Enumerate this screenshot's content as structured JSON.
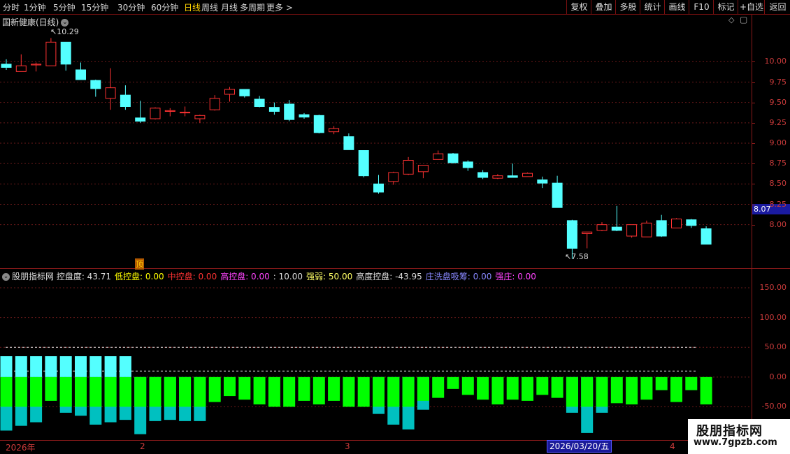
{
  "toolbar": {
    "periods": [
      "分时",
      "1分钟",
      "5分钟",
      "15分钟",
      "30分钟",
      "60分钟",
      "日线",
      "周线",
      "月线",
      "多周期",
      "更多 >"
    ],
    "active_period": "日线",
    "right_buttons": [
      "复权",
      "叠加",
      "多股",
      "统计",
      "画线",
      "F10",
      "标记",
      "+自选",
      "返回"
    ]
  },
  "chart": {
    "title": "国新健康(日线)",
    "high_label": "10.29",
    "low_label": "7.58",
    "current_price": "8.07",
    "marker": "顶",
    "y_ticks": [
      "10.00",
      "9.75",
      "9.50",
      "9.25",
      "9.00",
      "8.75",
      "8.50",
      "8.25",
      "8.00"
    ]
  },
  "indicator": {
    "name": "股朋指标网",
    "fields": [
      {
        "label": "控盘度:",
        "value": "43.71",
        "color": "#dddddd"
      },
      {
        "label": "低控盘:",
        "value": "0.00",
        "color": "#ffff00"
      },
      {
        "label": "中控盘:",
        "value": "0.00",
        "color": "#ff3333"
      },
      {
        "label": "高控盘:",
        "value": "0.00",
        "color": "#ff44ff"
      },
      {
        "label": ":",
        "value": "10.00",
        "color": "#dddddd"
      },
      {
        "label": "强弱:",
        "value": "50.00",
        "color": "#ffff66"
      },
      {
        "label": "高度控盘:",
        "value": "-43.95",
        "color": "#dddddd"
      },
      {
        "label": "庄洗盘吸筹:",
        "value": "0.00",
        "color": "#8888ff"
      },
      {
        "label": "强庄:",
        "value": "0.00",
        "color": "#ff44ff"
      }
    ],
    "y_ticks": [
      "150.00",
      "100.00",
      "50.00",
      "0.00",
      "-50.00"
    ]
  },
  "dates": {
    "year": "2026年",
    "m2": "2",
    "m3": "3",
    "m4": "4",
    "cursor": "2026/03/20/五"
  },
  "watermark": {
    "line1": "股朋指标网",
    "line2": "www.7gpzb.com"
  },
  "colors": {
    "up": "#ff3232",
    "down": "#54ffff",
    "grid": "#6a1a1a",
    "bar_green": "#00ff00",
    "bar_teal": "#00c0c0"
  },
  "chart_data": {
    "type": "candlestick",
    "ohlc": [
      [
        9.97,
        10.03,
        9.9,
        9.93
      ],
      [
        9.88,
        10.09,
        9.88,
        9.95
      ],
      [
        9.96,
        9.99,
        9.88,
        9.97
      ],
      [
        9.95,
        10.29,
        9.95,
        10.24
      ],
      [
        10.24,
        10.24,
        9.89,
        9.97
      ],
      [
        9.9,
        9.99,
        9.78,
        9.78
      ],
      [
        9.77,
        9.78,
        9.57,
        9.67
      ],
      [
        9.55,
        9.92,
        9.41,
        9.68
      ],
      [
        9.59,
        9.71,
        9.41,
        9.45
      ],
      [
        9.31,
        9.52,
        9.25,
        9.27
      ],
      [
        9.3,
        9.44,
        9.29,
        9.43
      ],
      [
        9.39,
        9.43,
        9.33,
        9.4
      ],
      [
        9.38,
        9.45,
        9.33,
        9.38
      ],
      [
        9.3,
        9.35,
        9.25,
        9.34
      ],
      [
        9.41,
        9.59,
        9.4,
        9.55
      ],
      [
        9.6,
        9.69,
        9.51,
        9.66
      ],
      [
        9.66,
        9.66,
        9.56,
        9.58
      ],
      [
        9.54,
        9.58,
        9.44,
        9.45
      ],
      [
        9.44,
        9.5,
        9.35,
        9.39
      ],
      [
        9.48,
        9.53,
        9.27,
        9.29
      ],
      [
        9.35,
        9.37,
        9.3,
        9.32
      ],
      [
        9.34,
        9.35,
        9.12,
        9.13
      ],
      [
        9.14,
        9.21,
        9.11,
        9.18
      ],
      [
        9.08,
        9.12,
        8.92,
        8.92
      ],
      [
        8.91,
        8.9,
        8.58,
        8.6
      ],
      [
        8.5,
        8.61,
        8.38,
        8.4
      ],
      [
        8.53,
        8.65,
        8.49,
        8.64
      ],
      [
        8.62,
        8.83,
        8.61,
        8.79
      ],
      [
        8.65,
        8.73,
        8.57,
        8.73
      ],
      [
        8.8,
        8.91,
        8.8,
        8.87
      ],
      [
        8.87,
        8.88,
        8.75,
        8.76
      ],
      [
        8.77,
        8.79,
        8.66,
        8.7
      ],
      [
        8.64,
        8.67,
        8.56,
        8.58
      ],
      [
        8.57,
        8.62,
        8.56,
        8.6
      ],
      [
        8.6,
        8.75,
        8.58,
        8.58
      ],
      [
        8.59,
        8.64,
        8.59,
        8.63
      ],
      [
        8.55,
        8.59,
        8.45,
        8.51
      ],
      [
        8.51,
        8.6,
        8.21,
        8.21
      ],
      [
        8.05,
        8.06,
        7.58,
        7.71
      ],
      [
        7.89,
        7.91,
        7.71,
        7.91
      ],
      [
        7.93,
        8.03,
        7.92,
        8.0
      ],
      [
        7.97,
        8.23,
        7.92,
        7.93
      ],
      [
        7.86,
        8.0,
        7.84,
        8.0
      ],
      [
        7.85,
        8.05,
        7.85,
        8.02
      ],
      [
        8.05,
        8.12,
        7.85,
        7.86
      ],
      [
        7.96,
        8.08,
        7.96,
        8.07
      ],
      [
        8.06,
        8.07,
        7.96,
        7.99
      ],
      [
        7.95,
        7.98,
        7.76,
        7.76
      ]
    ],
    "ylim": [
      7.5,
      10.5
    ],
    "indicator_bars_pos": [
      35,
      35,
      35,
      35,
      35,
      35,
      35,
      35,
      35,
      0,
      0,
      0,
      0,
      0,
      0,
      0,
      0,
      0,
      0,
      0,
      0,
      0,
      0,
      0,
      0,
      0,
      0,
      0,
      0,
      0,
      0,
      0,
      0,
      0,
      0,
      0,
      0,
      0,
      0,
      0,
      0,
      0,
      0,
      0,
      0,
      0,
      0,
      0
    ],
    "indicator_green": [
      -50,
      -50,
      -50,
      -40,
      -50,
      -50,
      -50,
      -50,
      -50,
      -50,
      -50,
      -50,
      -50,
      -50,
      -42,
      -32,
      -38,
      -46,
      -50,
      -50,
      -40,
      -46,
      -40,
      -50,
      -50,
      -50,
      -50,
      -50,
      -40,
      -35,
      -20,
      -30,
      -38,
      -46,
      -38,
      -40,
      -30,
      -35,
      -50,
      -50,
      -50,
      -44,
      -46,
      -38,
      -22,
      -42,
      -22,
      -46
    ],
    "indicator_teal": [
      -90,
      -82,
      -76,
      0,
      -60,
      -65,
      -80,
      -76,
      -72,
      -96,
      -74,
      -72,
      -74,
      -74,
      0,
      0,
      0,
      0,
      0,
      0,
      0,
      0,
      0,
      0,
      0,
      -62,
      -80,
      -88,
      -55,
      0,
      0,
      0,
      0,
      0,
      0,
      0,
      0,
      0,
      -60,
      -94,
      -60,
      0,
      0,
      0,
      0,
      0,
      0,
      0
    ],
    "ind_ylim": [
      -100,
      170
    ],
    "ref_lines": [
      50,
      10
    ]
  }
}
